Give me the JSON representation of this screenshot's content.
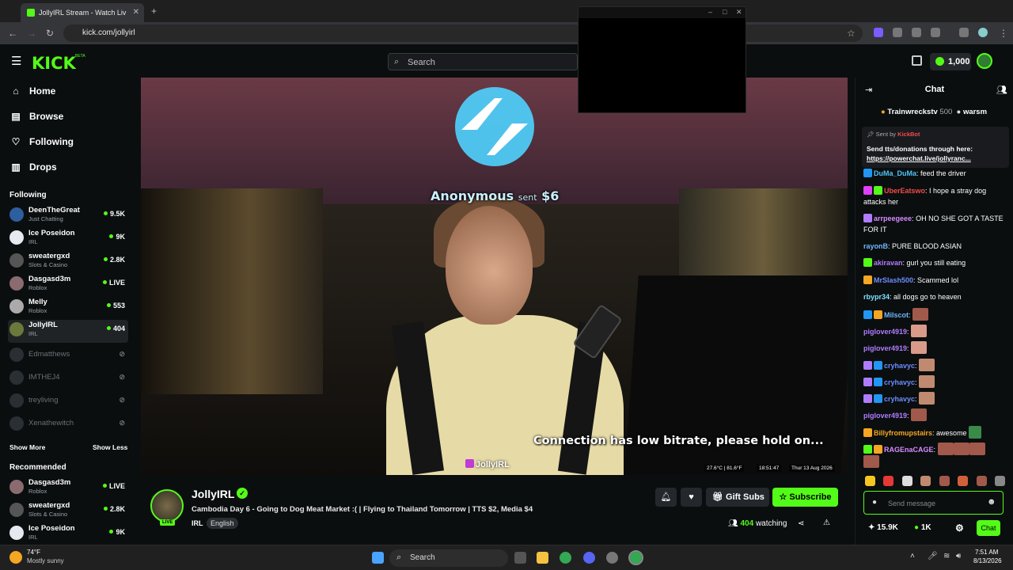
{
  "browser": {
    "tab_title": "JollyIRL Stream - Watch Liv",
    "url": "kick.com/jollyirl"
  },
  "header": {
    "logo": "KICK",
    "logo_badge": "BETA",
    "search_placeholder": "Search",
    "coins": "1,000"
  },
  "sidebar": {
    "nav": [
      {
        "label": "Home",
        "icon": "home-icon"
      },
      {
        "label": "Browse",
        "icon": "browse-icon"
      },
      {
        "label": "Following",
        "icon": "heart-icon"
      },
      {
        "label": "Drops",
        "icon": "drops-icon"
      }
    ],
    "following_title": "Following",
    "following": [
      {
        "name": "DeenTheGreat",
        "category": "Just Chatting",
        "viewers": "9.5K"
      },
      {
        "name": "Ice Poseidon",
        "category": "IRL",
        "viewers": "9K"
      },
      {
        "name": "sweatergxd",
        "category": "Slots & Casino",
        "viewers": "2.8K"
      },
      {
        "name": "Dasgasd3m",
        "category": "Roblox",
        "viewers": "LIVE"
      },
      {
        "name": "Melly",
        "category": "Roblox",
        "viewers": "553"
      },
      {
        "name": "JollyIRL",
        "category": "IRL",
        "viewers": "404"
      }
    ],
    "offline": [
      "Edmatthews",
      "IMTHEJ4",
      "treyliving",
      "Xenathewitch"
    ],
    "show_more": "Show More",
    "show_less": "Show Less",
    "recommended_title": "Recommended",
    "recommended": [
      {
        "name": "Dasgasd3m",
        "category": "Roblox",
        "viewers": "LIVE"
      },
      {
        "name": "sweatergxd",
        "category": "Slots & Casino",
        "viewers": "2.8K"
      },
      {
        "name": "Ice Poseidon",
        "category": "IRL",
        "viewers": "9K"
      }
    ]
  },
  "video": {
    "alert_name": "Anonymous",
    "alert_sent": "sent",
    "alert_amount": "$6",
    "lowbitrate": "Connection has low bitrate, please hold on...",
    "watermark": "JollyIRL",
    "hud": [
      "27.6°C | 81.6°F",
      "18:51:47",
      "Thur 13 Aug 2026"
    ]
  },
  "stream": {
    "name": "JollyIRL",
    "live_badge": "LIVE",
    "title": "Cambodia Day 6 - Going to Dog Meat Market :( | Flying to Thailand Tomorrow | TTS $2, Media $4",
    "category": "IRL",
    "language": "English",
    "gift_label": "Gift Subs",
    "subscribe_label": "Subscribe",
    "viewers": "404",
    "viewers_label": "watching"
  },
  "chat": {
    "title": "Chat",
    "top_gifters": [
      {
        "name": "Trainwreckstv",
        "count": "500"
      },
      {
        "name": "warsm",
        "count": ""
      }
    ],
    "pinned": {
      "sent_by": "Sent by",
      "sender": "KickBot",
      "text": "Send tts/donations through here:",
      "link": "https://powerchat.live/jollyranc..."
    },
    "messages": [
      {
        "user": "DuMa_DuMa",
        "color": "#4fc3f7",
        "text": "feed the driver"
      },
      {
        "user": "UberEatswo",
        "color": "#f24b4b",
        "text": "I hope a stray dog attacks her"
      },
      {
        "user": "arrpeegeee",
        "color": "#d68cff",
        "text": "OH NO SHE GOT A TASTE FOR IT"
      },
      {
        "user": "rayonB",
        "color": "#6db7ff",
        "text": "PURE BLOOD ASIAN"
      },
      {
        "user": "akiravan",
        "color": "#b07cff",
        "text": "gurl you still eating"
      },
      {
        "user": "MrSlash500",
        "color": "#6b8dff",
        "text": "Scammed lol"
      },
      {
        "user": "rbypr34",
        "color": "#7ee0ff",
        "text": "all dogs go to heaven"
      },
      {
        "user": "Milscot",
        "color": "#6db7ff",
        "text": ""
      },
      {
        "user": "piglover4919",
        "color": "#b07cff",
        "text": ""
      },
      {
        "user": "piglover4919",
        "color": "#b07cff",
        "text": ""
      },
      {
        "user": "cryhavyc",
        "color": "#6b8dff",
        "text": ""
      },
      {
        "user": "cryhavyc",
        "color": "#6b8dff",
        "text": ""
      },
      {
        "user": "cryhavyc",
        "color": "#6b8dff",
        "text": ""
      },
      {
        "user": "piglover4919",
        "color": "#b07cff",
        "text": ""
      },
      {
        "user": "Billyfromupstairs",
        "color": "#f5a623",
        "text": "awesome"
      },
      {
        "user": "RAGEnaCAGE",
        "color": "#d68cff",
        "text": ""
      }
    ],
    "input_placeholder": "Send message",
    "followers": "15.9K",
    "points": "1K",
    "chat_button": "Chat"
  },
  "taskbar": {
    "weather_temp": "74°F",
    "weather_desc": "Mostly sunny",
    "search": "Search",
    "time": "7:51 AM",
    "date": "8/13/2026"
  },
  "colors": {
    "kick_green": "#53fc18",
    "background": "#0b0e0f"
  }
}
